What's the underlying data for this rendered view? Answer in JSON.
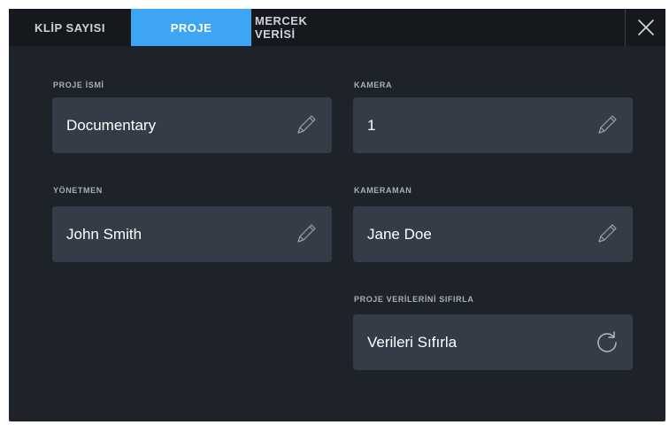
{
  "tabs": [
    {
      "label": "KLİP SAYISI",
      "active": false
    },
    {
      "label": "PROJE",
      "active": true
    },
    {
      "label": "MERCEK VERİSİ",
      "active": false
    }
  ],
  "close_icon": "close-icon",
  "fields": {
    "project_name": {
      "label": "PROJE İSMİ",
      "value": "Documentary",
      "icon": "pencil-icon"
    },
    "camera": {
      "label": "KAMERA",
      "value": "1",
      "icon": "pencil-icon"
    },
    "director": {
      "label": "YÖNETMEN",
      "value": "John Smith",
      "icon": "pencil-icon"
    },
    "camera_operator": {
      "label": "KAMERAMAN",
      "value": "Jane Doe",
      "icon": "pencil-icon"
    },
    "reset": {
      "label": "PROJE VERİLERİNİ SIFIRLA",
      "value": "Verileri Sıfırla",
      "icon": "refresh-icon"
    }
  },
  "colors": {
    "panel_bg": "#1e232a",
    "tabbar_bg": "#15191e",
    "active_tab": "#3ea4f4",
    "field_bg": "#343c48"
  }
}
